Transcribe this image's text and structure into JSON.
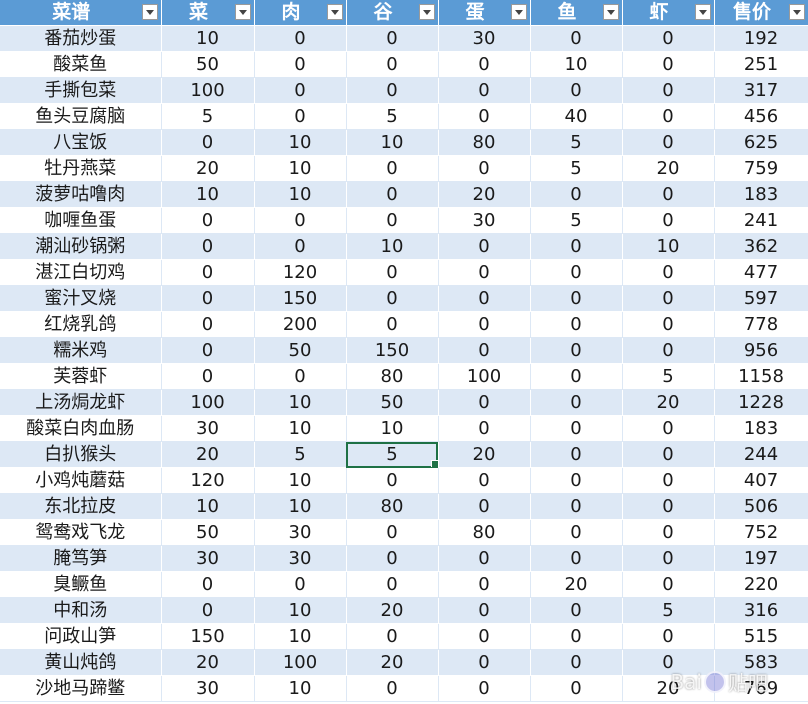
{
  "columns": [
    "菜谱",
    "菜",
    "肉",
    "谷",
    "蛋",
    "鱼",
    "虾",
    "售价"
  ],
  "rows": [
    [
      "番茄炒蛋",
      "10",
      "0",
      "0",
      "30",
      "0",
      "0",
      "192"
    ],
    [
      "酸菜鱼",
      "50",
      "0",
      "0",
      "0",
      "10",
      "0",
      "251"
    ],
    [
      "手撕包菜",
      "100",
      "0",
      "0",
      "0",
      "0",
      "0",
      "317"
    ],
    [
      "鱼头豆腐脑",
      "5",
      "0",
      "5",
      "0",
      "40",
      "0",
      "456"
    ],
    [
      "八宝饭",
      "0",
      "10",
      "10",
      "80",
      "5",
      "0",
      "625"
    ],
    [
      "牡丹燕菜",
      "20",
      "10",
      "0",
      "0",
      "5",
      "20",
      "759"
    ],
    [
      "菠萝咕噜肉",
      "10",
      "10",
      "0",
      "20",
      "0",
      "0",
      "183"
    ],
    [
      "咖喱鱼蛋",
      "0",
      "0",
      "0",
      "30",
      "5",
      "0",
      "241"
    ],
    [
      "潮汕砂锅粥",
      "0",
      "0",
      "10",
      "0",
      "0",
      "10",
      "362"
    ],
    [
      "湛江白切鸡",
      "0",
      "120",
      "0",
      "0",
      "0",
      "0",
      "477"
    ],
    [
      "蜜汁叉烧",
      "0",
      "150",
      "0",
      "0",
      "0",
      "0",
      "597"
    ],
    [
      "红烧乳鸽",
      "0",
      "200",
      "0",
      "0",
      "0",
      "0",
      "778"
    ],
    [
      "糯米鸡",
      "0",
      "50",
      "150",
      "0",
      "0",
      "0",
      "956"
    ],
    [
      "芙蓉虾",
      "0",
      "0",
      "80",
      "100",
      "0",
      "5",
      "1158"
    ],
    [
      "上汤焗龙虾",
      "100",
      "10",
      "50",
      "0",
      "0",
      "20",
      "1228"
    ],
    [
      "酸菜白肉血肠",
      "30",
      "10",
      "10",
      "0",
      "0",
      "0",
      "183"
    ],
    [
      "白扒猴头",
      "20",
      "5",
      "5",
      "20",
      "0",
      "0",
      "244"
    ],
    [
      "小鸡炖蘑菇",
      "120",
      "10",
      "0",
      "0",
      "0",
      "0",
      "407"
    ],
    [
      "东北拉皮",
      "10",
      "10",
      "80",
      "0",
      "0",
      "0",
      "506"
    ],
    [
      "鸳鸯戏飞龙",
      "50",
      "30",
      "0",
      "80",
      "0",
      "0",
      "752"
    ],
    [
      "腌笃笋",
      "30",
      "30",
      "0",
      "0",
      "0",
      "0",
      "197"
    ],
    [
      "臭鳜鱼",
      "0",
      "0",
      "0",
      "0",
      "20",
      "0",
      "220"
    ],
    [
      "中和汤",
      "0",
      "10",
      "20",
      "0",
      "0",
      "5",
      "316"
    ],
    [
      "问政山笋",
      "150",
      "10",
      "0",
      "0",
      "0",
      "0",
      "515"
    ],
    [
      "黄山炖鸽",
      "20",
      "100",
      "20",
      "0",
      "0",
      "0",
      "583"
    ],
    [
      "沙地马蹄鳖",
      "30",
      "10",
      "0",
      "0",
      "0",
      "20",
      "769"
    ]
  ],
  "selected_cell": {
    "row": 16,
    "col": 3
  },
  "watermark": {
    "text": "Bai",
    "suffix": "贴吧"
  },
  "colors": {
    "header_bg": "#5b9bd5",
    "band_bg": "#dde8f5",
    "selection": "#1e7145"
  }
}
